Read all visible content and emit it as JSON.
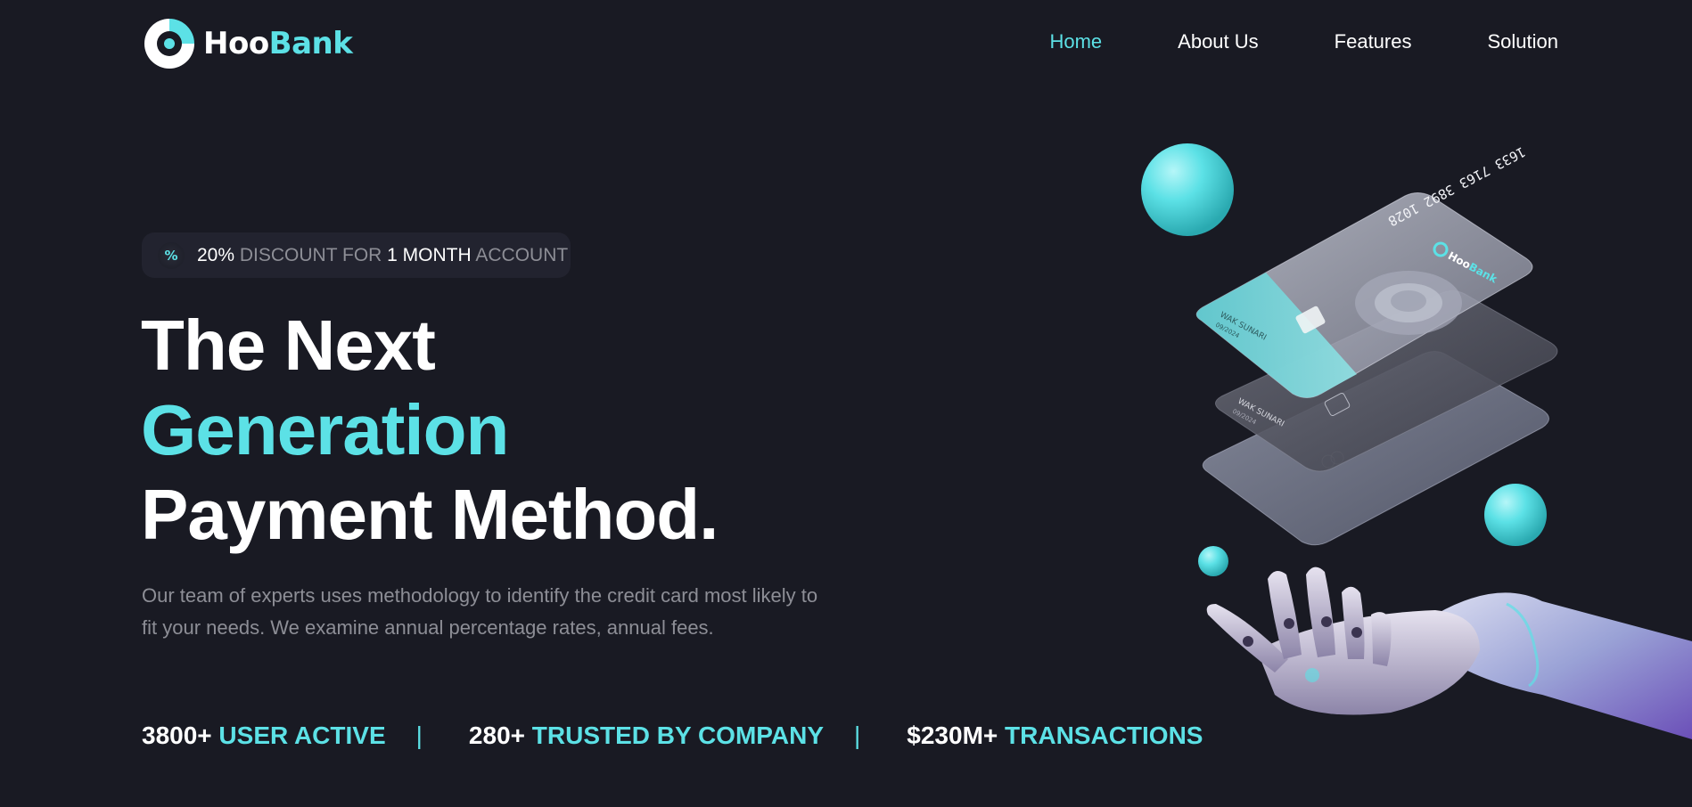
{
  "brand": {
    "name_part1": "Hoo",
    "name_part2": "Bank",
    "accent": "#5ce1e6",
    "background": "#191a23"
  },
  "nav": {
    "items": [
      {
        "label": "Home",
        "active": true
      },
      {
        "label": "About Us",
        "active": false
      },
      {
        "label": "Features",
        "active": false
      },
      {
        "label": "Solution",
        "active": false
      }
    ]
  },
  "badge": {
    "icon": "percent-icon",
    "discount": "20%",
    "text1": "DISCOUNT FOR",
    "duration": "1 MONTH",
    "text2": "ACCOUNT"
  },
  "hero": {
    "line1": "The Next",
    "line2": "Generation",
    "line3": "Payment Method.",
    "description": "Our team of experts uses methodology to identify the credit card most likely to fit your needs. We examine annual percentage rates, annual fees."
  },
  "stats": [
    {
      "value": "3800+",
      "label": "USER ACTIVE"
    },
    {
      "value": "280+",
      "label": "TRUSTED BY COMPANY"
    },
    {
      "value": "$230M+",
      "label": "TRANSACTIONS"
    }
  ],
  "separator": "|",
  "illustration": {
    "card_number": "1633 7163 3892 1028",
    "card_holder": "WAK SUNARI",
    "card_expiry": "09/2024",
    "card_brand_part1": "Hoo",
    "card_brand_part2": "Bank"
  }
}
